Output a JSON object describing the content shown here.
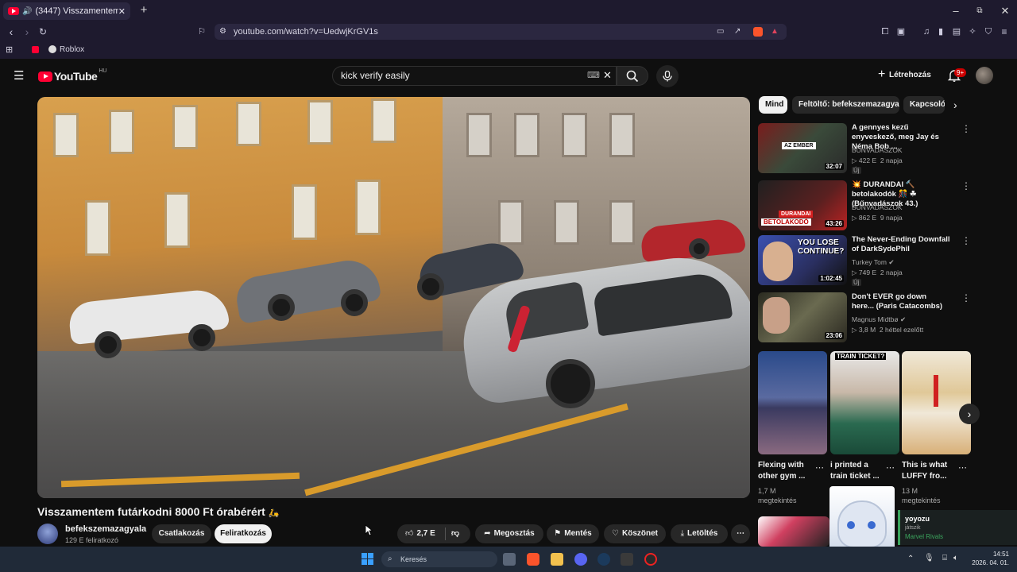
{
  "browser": {
    "tab_title": "(3447) Visszamentem futárk",
    "url": "youtube.com/watch?v=UedwjKrGV1s",
    "bookmark": "Roblox",
    "accent_color": "#1e1a2e"
  },
  "masthead": {
    "logo_text": "YouTube",
    "region": "HU",
    "search_value": "kick verify easily",
    "create_label": "Létrehozás",
    "notif_count": "9+"
  },
  "video": {
    "title": "Visszamentem futárkodni 8000 Ft órabérért",
    "channel_name": "befekszemazagyala",
    "subscribers": "129 E feliratkozó",
    "join_label": "Csatlakozás",
    "subscribe_label": "Feliratkozás",
    "like_count": "2,7 E",
    "share_label": "Megosztás",
    "save_label": "Mentés",
    "thanks_label": "Köszönet",
    "download_label": "Letöltés"
  },
  "chips": [
    "Mind",
    "Feltöltő: befekszemazagyala",
    "Kapcsoló"
  ],
  "recommendations": [
    {
      "title": "A gennyes kezű enyveskező, meg Jay és Néma Bob ...",
      "channel": "BŰNVADÁSZOK",
      "views": "422 E",
      "age": "2 napja",
      "duration": "32:07",
      "new": "Új"
    },
    {
      "title": "💥 DURANDAI 🔨 betolakodók 🎊 ☘ (Bűnvadászok 43.)",
      "channel": "BŰNVADÁSZOK",
      "views": "862 E",
      "age": "9 napja",
      "duration": "43:26",
      "new": ""
    },
    {
      "title": "The Never-Ending Downfall of DarkSydePhil",
      "channel": "Turkey Tom",
      "views": "749 E",
      "age": "2 napja",
      "duration": "1:02:45",
      "new": "Új"
    },
    {
      "title": "Don't EVER go down here... (Paris Catacombs)",
      "channel": "Magnus Midtbø",
      "views": "3,8 M",
      "age": "2 héttel ezelőtt",
      "duration": "23:06",
      "new": ""
    }
  ],
  "shorts": [
    {
      "title": "Flexing with other gym ...",
      "views": "1,7 M",
      "views_label": "megtekintés"
    },
    {
      "title": "i printed a train ticket ...",
      "views": "",
      "views_label": ""
    },
    {
      "title": "This is what LUFFY fro...",
      "views": "13 M",
      "views_label": "megtekintés"
    }
  ],
  "shorts_thumb_text": {
    "second": "TRAIN TICKET?"
  },
  "thumb_texts": {
    "rec1": "AZ EMBER",
    "rec2_banner": "DURANDAI",
    "rec2_sub": "BETOLAKODÓ",
    "rec3": "YOU LOSE CONTINUE?"
  },
  "overlay": {
    "name": "yoyozu",
    "status": "játszik",
    "game": "Marvel Rivals"
  },
  "taskbar": {
    "search_placeholder": "Keresés",
    "time": "14:51",
    "date": "2026. 04. 01."
  }
}
